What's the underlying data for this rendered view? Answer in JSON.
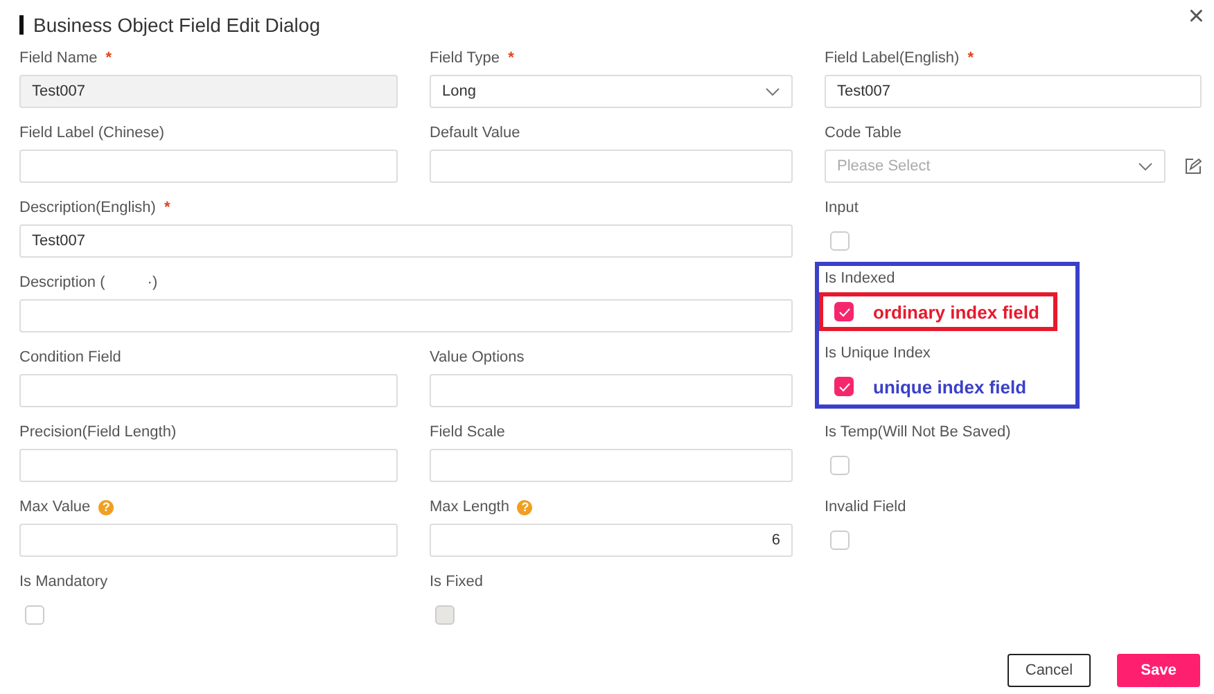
{
  "dialog": {
    "title": "Business Object Field Edit Dialog",
    "close": "×"
  },
  "fields": [
    {
      "kind": "input",
      "label": "Field Name",
      "required": "*",
      "value": "Test007",
      "disabled": true
    },
    {
      "kind": "select",
      "label": "Field Type",
      "required": "*",
      "value": "Long"
    },
    {
      "kind": "input",
      "label": "Field Label(English)",
      "required": "*",
      "value": "Test007"
    },
    {
      "kind": "input",
      "label": "Field Label (Chinese)"
    },
    {
      "kind": "input",
      "label": "Default Value"
    },
    {
      "kind": "select",
      "label": "Code Table",
      "placeholder": "Please Select",
      "editable": true
    },
    {
      "kind": "input",
      "label": "Description(English)",
      "required": "*",
      "value": "Test007",
      "wide": true
    },
    {
      "kind": "checkbox",
      "label": "Input",
      "checked": false
    },
    {
      "kind": "input",
      "label": "Description (          ·)",
      "wide": true
    },
    {
      "kind": "group",
      "color": "#3b40c8",
      "fields": [
        {
          "kind": "checkbox",
          "label": "Is Indexed",
          "checked": true,
          "note": {
            "text": "ordinary index field",
            "color": "#e8192c",
            "framed": true
          }
        },
        {
          "kind": "checkbox",
          "label": "Is Unique Index",
          "checked": true,
          "note": {
            "text": "unique index field",
            "color": "#3b40c8",
            "framed": false
          }
        }
      ]
    },
    {
      "kind": "input",
      "label": "Condition Field"
    },
    {
      "kind": "input",
      "label": "Value Options"
    },
    {
      "kind": "input",
      "label": "Precision(Field Length)"
    },
    {
      "kind": "input",
      "label": "Field Scale"
    },
    {
      "kind": "checkbox",
      "label": "Is Temp(Will Not Be Saved)",
      "checked": false
    },
    {
      "kind": "input",
      "label": "Max Value",
      "help": "?"
    },
    {
      "kind": "input",
      "label": "Max Length",
      "help": "?",
      "value": "6",
      "right_aligned": true
    },
    {
      "kind": "checkbox",
      "label": "Invalid Field",
      "checked": false
    },
    {
      "kind": "checkbox",
      "label": "Is Mandatory",
      "checked": false
    },
    {
      "kind": "checkbox",
      "label": "Is Fixed",
      "checked": false,
      "disabled": true
    }
  ],
  "buttons": [
    {
      "label": "Cancel",
      "kind": "secondary"
    },
    {
      "label": "Save",
      "kind": "primary"
    }
  ]
}
